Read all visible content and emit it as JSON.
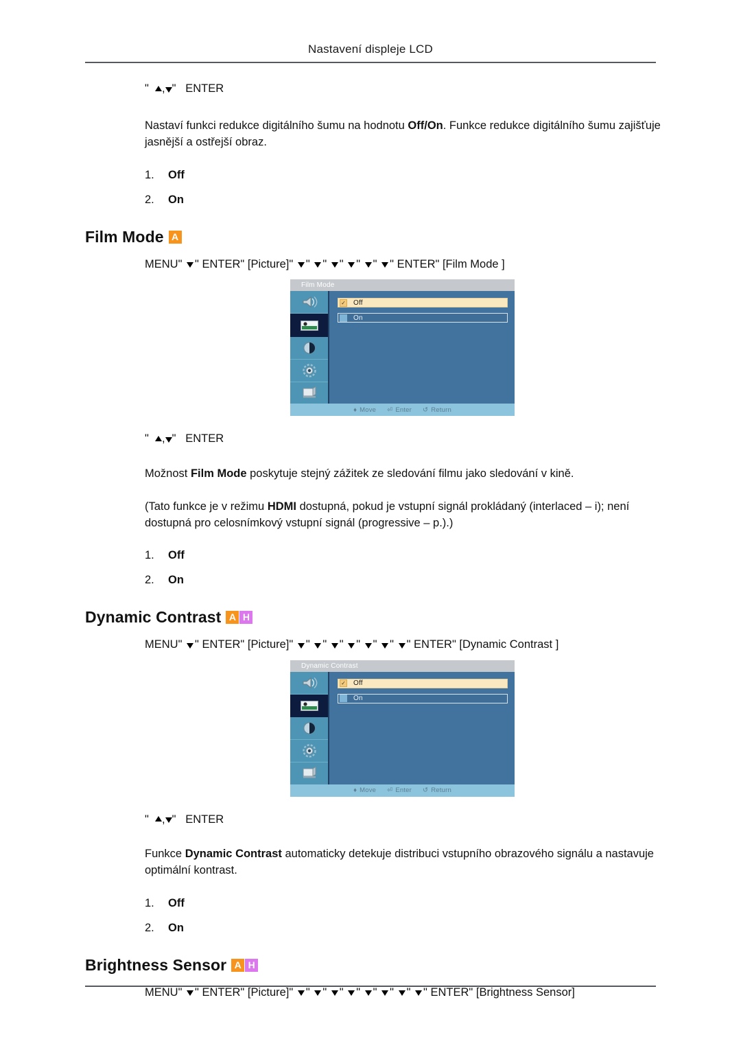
{
  "header": {
    "title": "Nastavení displeje LCD"
  },
  "sections": {
    "noise_reduction_tail": {
      "keyline": {
        "quote_open": "\"",
        "comma": ",",
        "quote_close": "\"",
        "enter": "ENTER"
      },
      "paragraph_pre": "Nastaví funkci redukce digitálního šumu na hodnotu ",
      "paragraph_bold": "Off/On",
      "paragraph_post": ". Funkce redukce digitálního šumu zajišťuje jasnější a ostřejší obraz.",
      "options": [
        {
          "num": "1.",
          "value": "Off"
        },
        {
          "num": "2.",
          "value": "On"
        }
      ]
    },
    "film_mode": {
      "heading": "Film Mode",
      "badges": [
        {
          "letter": "A",
          "color": "#f7941e"
        }
      ],
      "menu_path": {
        "menu": "MENU",
        "enter1": "ENTER",
        "picture": "[Picture]",
        "down_count": 6,
        "enter2": "ENTER",
        "target": "[Film Mode ]",
        "quote": "\""
      },
      "osd": {
        "title": "Film Mode",
        "rows": [
          {
            "label": "Off",
            "selected": true
          },
          {
            "label": "On",
            "selected": false
          }
        ],
        "footer": [
          {
            "icon": "move-icon",
            "glyph": "♦",
            "label": "Move"
          },
          {
            "icon": "enter-icon",
            "glyph": "⏎",
            "label": "Enter"
          },
          {
            "icon": "return-icon",
            "glyph": "↺",
            "label": "Return"
          }
        ],
        "sidebar_icons": [
          {
            "name": "audio-icon",
            "selected": false
          },
          {
            "name": "picture-icon",
            "selected": true
          },
          {
            "name": "contrast-icon",
            "selected": false
          },
          {
            "name": "setup-icon",
            "selected": false
          },
          {
            "name": "display-icon",
            "selected": false
          }
        ]
      },
      "keyline2": {
        "quote_open": "\"",
        "comma": ",",
        "quote_close": "\"",
        "enter": "ENTER"
      },
      "paragraph1_pre": "Možnost ",
      "paragraph1_bold": "Film Mode",
      "paragraph1_post": " poskytuje stejný zážitek ze sledování filmu jako sledování v kině.",
      "paragraph2_pre": "(Tato funkce je v režimu ",
      "paragraph2_bold": "HDMI",
      "paragraph2_post": " dostupná, pokud je vstupní signál prokládaný (interlaced – i); není dostupná pro celosnímkový vstupní signál (progressive – p.).)",
      "options": [
        {
          "num": "1.",
          "value": "Off"
        },
        {
          "num": "2.",
          "value": "On"
        }
      ]
    },
    "dynamic_contrast": {
      "heading": "Dynamic Contrast",
      "badges": [
        {
          "letter": "A",
          "color": "#f7941e"
        },
        {
          "letter": "H",
          "color": "#dd77ee"
        }
      ],
      "menu_path": {
        "menu": "MENU",
        "enter1": "ENTER",
        "picture": "[Picture]",
        "down_count": 7,
        "enter2": "ENTER",
        "target": "[Dynamic Contrast ]",
        "quote": "\""
      },
      "osd": {
        "title": "Dynamic Contrast",
        "rows": [
          {
            "label": "Off",
            "selected": true
          },
          {
            "label": "On",
            "selected": false
          }
        ],
        "footer": [
          {
            "icon": "move-icon",
            "glyph": "♦",
            "label": "Move"
          },
          {
            "icon": "enter-icon",
            "glyph": "⏎",
            "label": "Enter"
          },
          {
            "icon": "return-icon",
            "glyph": "↺",
            "label": "Return"
          }
        ],
        "sidebar_icons": [
          {
            "name": "audio-icon",
            "selected": false
          },
          {
            "name": "picture-icon",
            "selected": true
          },
          {
            "name": "contrast-icon",
            "selected": false
          },
          {
            "name": "setup-icon",
            "selected": false
          },
          {
            "name": "display-icon",
            "selected": false
          }
        ]
      },
      "keyline2": {
        "quote_open": "\"",
        "comma": ",",
        "quote_close": "\"",
        "enter": "ENTER"
      },
      "paragraph_pre": "Funkce ",
      "paragraph_bold": "Dynamic Contrast",
      "paragraph_post": " automaticky detekuje distribuci vstupního obrazového signálu a nastavuje optimální kontrast.",
      "options": [
        {
          "num": "1.",
          "value": "Off"
        },
        {
          "num": "2.",
          "value": "On"
        }
      ]
    },
    "brightness_sensor": {
      "heading": "Brightness Sensor",
      "badges": [
        {
          "letter": "A",
          "color": "#f7941e"
        },
        {
          "letter": "H",
          "color": "#dd77ee"
        }
      ],
      "menu_path": {
        "menu": "MENU",
        "enter1": "ENTER",
        "picture": "[Picture]",
        "down_count": 8,
        "enter2": "ENTER",
        "target": "[Brightness Sensor]",
        "quote": "\""
      }
    }
  }
}
